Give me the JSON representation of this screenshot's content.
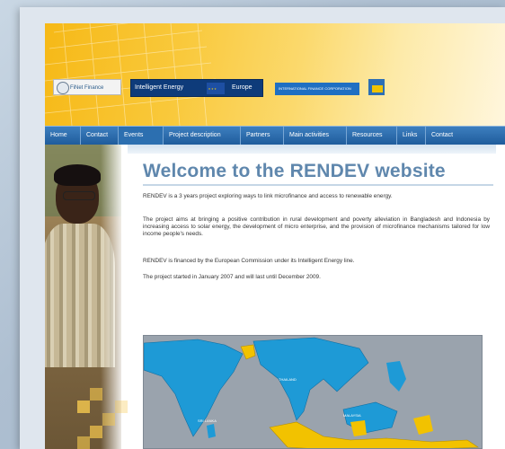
{
  "logos": {
    "finet": "FiNet Finance",
    "intelligent_energy": "Intelligent Energy",
    "europe": "Europe",
    "ifc": "INTERNATIONAL FINANCE CORPORATION"
  },
  "nav": {
    "items": [
      "Home",
      "Contact",
      "Events",
      "Project description",
      "Partners",
      "Main activities",
      "Resources",
      "Links",
      "Contact"
    ],
    "active": "Events"
  },
  "main": {
    "title": "Welcome to the RENDEV website",
    "paragraphs": [
      "RENDEV is a 3 years project exploring ways to link microfinance and access to renewable energy.",
      "The project aims at bringing a positive contribution in rural development and poverty alleviation in Bangladesh and Indonesia by increasing access to solar energy, the development of micro enterprise, and the provision of microfinance mechanisms tailored for low income people's needs.",
      "RENDEV is financed by the European Commission under its Intelligent Energy line.",
      "The project started in January 2007 and will last until December 2009."
    ]
  },
  "map": {
    "labels": [
      "THAILAND",
      "SRI LANKA",
      "MALAYSIA"
    ]
  },
  "colors": {
    "nav": "#1f5c9c",
    "title": "#5f87ad",
    "highlight_country": "#f2c200",
    "region": "#1e9ad6"
  }
}
